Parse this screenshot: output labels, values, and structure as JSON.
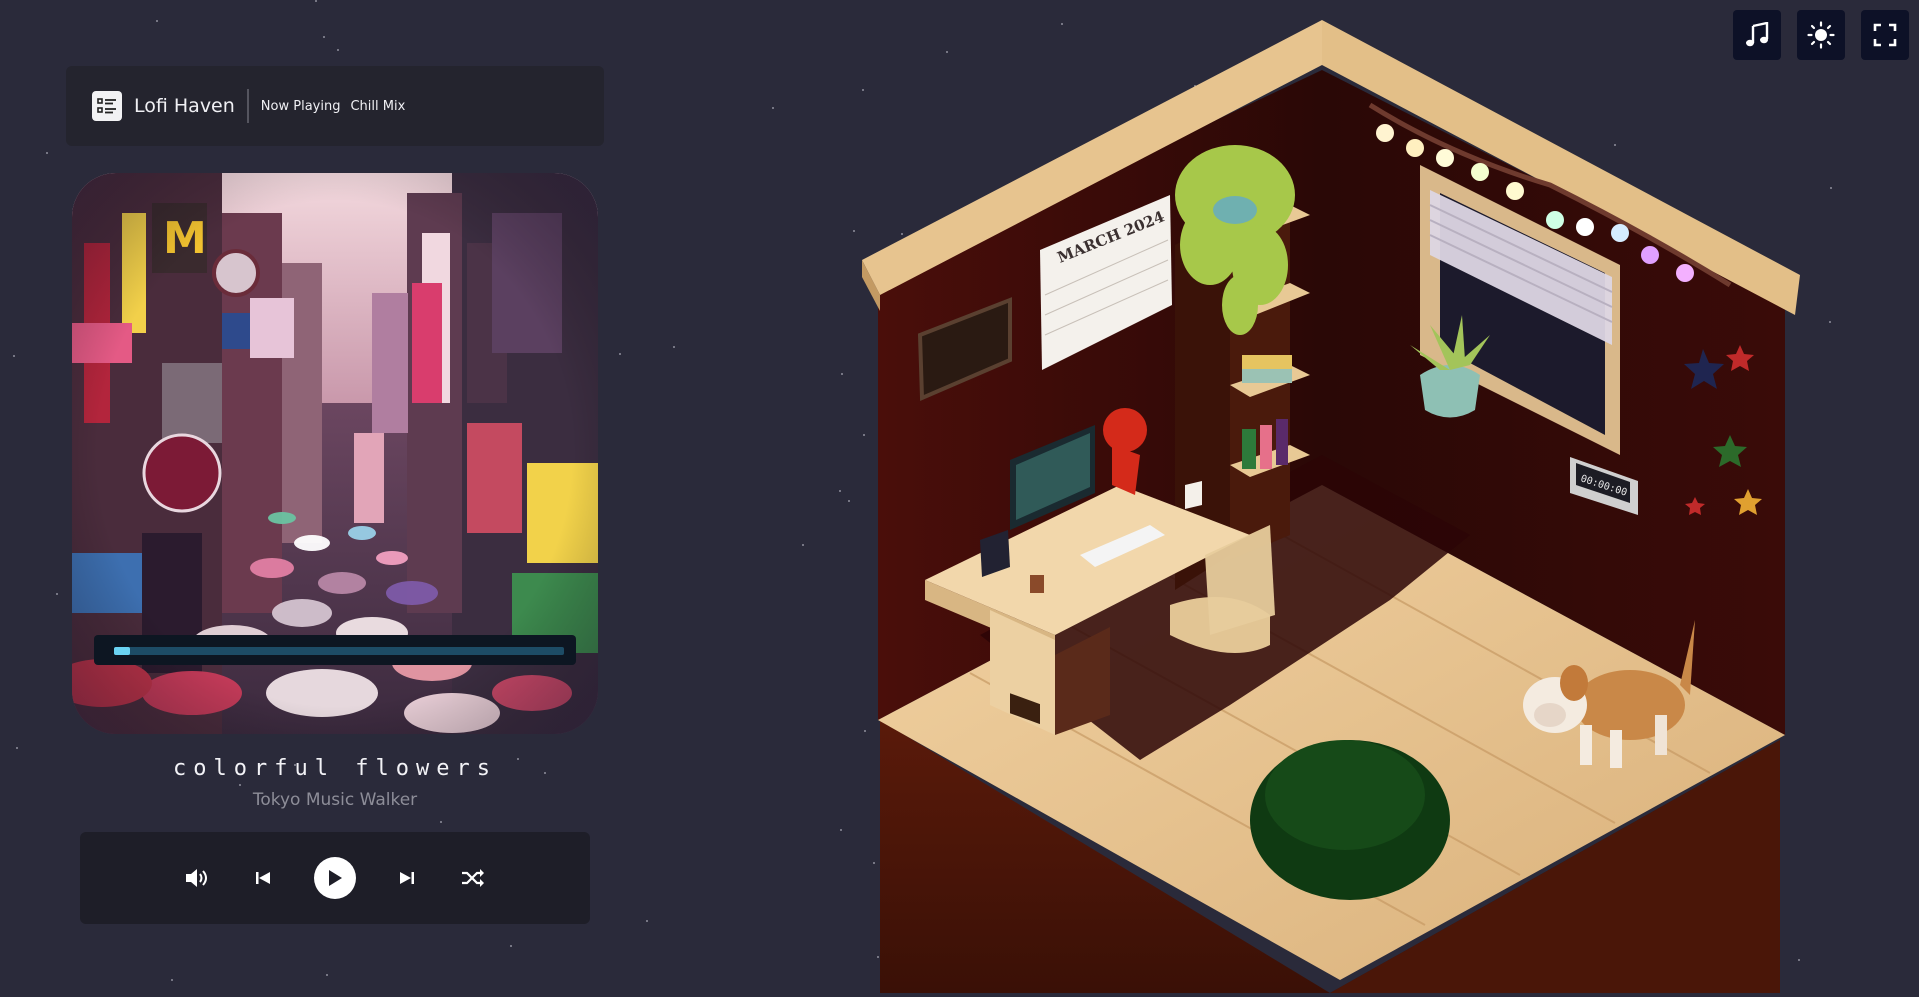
{
  "app": {
    "title": "Lofi Haven"
  },
  "header": {
    "now_playing_label": "Now Playing",
    "playlist": "Chill Mix"
  },
  "player": {
    "title": "colorful flowers",
    "artist": "Tokyo Music Walker",
    "progress": 0.035
  },
  "room": {
    "calendar": "MARCH 2024",
    "clock": "00:00:00"
  },
  "icons": {
    "menu": "playlist-icon",
    "volume": "volume-icon",
    "prev": "skip-back-icon",
    "play": "play-icon",
    "next": "skip-forward-icon",
    "shuffle": "shuffle-icon",
    "music": "music-note-icon",
    "theme": "sun-icon",
    "fullscreen": "fullscreen-icon"
  },
  "colors": {
    "background": "#2a2a3a",
    "panel": "#24242e",
    "accent": "#6ad2f2"
  }
}
